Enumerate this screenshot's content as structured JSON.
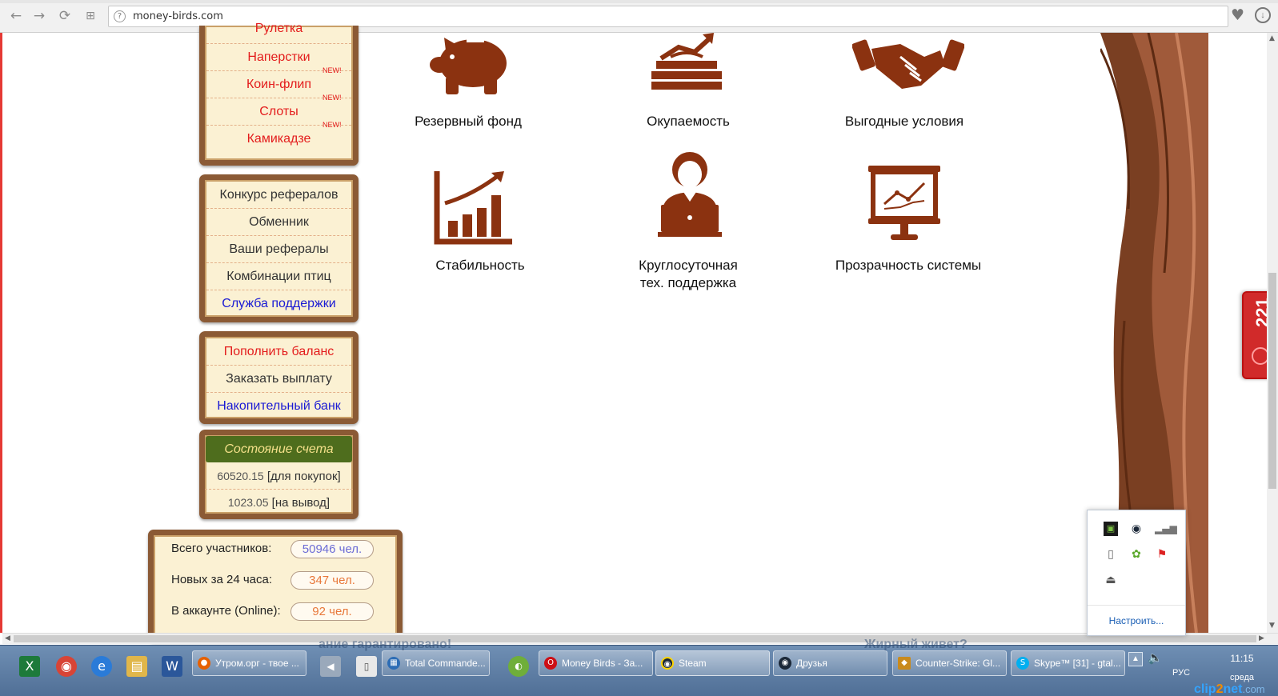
{
  "browser": {
    "url": "money-birds.com"
  },
  "sidebar": {
    "games": [
      {
        "label": "Рулетка",
        "color": "red",
        "new": false
      },
      {
        "label": "Наперстки",
        "color": "red",
        "new": false
      },
      {
        "label": "Коин-флип",
        "color": "red",
        "new": true
      },
      {
        "label": "Слоты",
        "color": "red",
        "new": true
      },
      {
        "label": "Камикадзе",
        "color": "red",
        "new": true
      }
    ],
    "new_tag": "NEW!",
    "referral": [
      {
        "label": "Конкурс рефералов",
        "color": "dark"
      },
      {
        "label": "Обменник",
        "color": "dark"
      },
      {
        "label": "Ваши рефералы",
        "color": "dark"
      },
      {
        "label": "Комбинации птиц",
        "color": "dark"
      },
      {
        "label": "Служба поддержки",
        "color": "blue"
      }
    ],
    "finance": [
      {
        "label": "Пополнить баланс",
        "color": "red"
      },
      {
        "label": "Заказать выплату",
        "color": "dark"
      },
      {
        "label": "Накопительный банк",
        "color": "blue"
      }
    ],
    "account_status": {
      "title": "Состояние счета",
      "purchase_amount": "60520.15",
      "purchase_label": "[для покупок]",
      "withdraw_amount": "1023.05",
      "withdraw_label": "[на вывод]"
    },
    "stats": [
      {
        "label": "Всего участников:",
        "value": "50946 чел.",
        "color": "#6b6bd6"
      },
      {
        "label": "Новых за 24 часа:",
        "value": "347 чел.",
        "color": "#e8783a"
      },
      {
        "label": "В аккаунте (Online):",
        "value": "92 чел.",
        "color": "#e8783a"
      }
    ]
  },
  "features": [
    {
      "label": "Резервный фонд",
      "icon": "piggy-bank-icon"
    },
    {
      "label": "Окупаемость",
      "icon": "money-stack-icon"
    },
    {
      "label": "Выгодные условия",
      "icon": "handshake-icon"
    },
    {
      "label": "Стабильность",
      "icon": "growth-chart-icon"
    },
    {
      "label_line1": "Круглосуточная",
      "label_line2": "тех. поддержка",
      "icon": "support-operator-icon"
    },
    {
      "label": "Прозрачность системы",
      "icon": "presentation-board-icon"
    }
  ],
  "side_widget": {
    "count": "221"
  },
  "tray_popup": {
    "customize_link": "Настроить..."
  },
  "taskbar": {
    "buttons": [
      {
        "label": "Утром.орг - твое ...",
        "icon": "firefox-icon",
        "color": "#e66000"
      },
      {
        "label": "Total Commande...",
        "icon": "total-commander-icon",
        "color": "#2d6db5"
      },
      {
        "label": "Money Birds - За...",
        "icon": "opera-icon",
        "color": "#cc0f16"
      },
      {
        "label": "Steam",
        "icon": "steam-icon",
        "color": "#1b2838"
      },
      {
        "label": "Друзья",
        "icon": "steam-icon",
        "color": "#1b2838"
      },
      {
        "label": "Counter-Strike: Gl...",
        "icon": "csgo-icon",
        "color": "#c98a1c"
      },
      {
        "label": "Skype™ [31] - gtal...",
        "icon": "skype-icon",
        "color": "#00aff0"
      }
    ],
    "ghost_text_1": "ание гарантировано!",
    "ghost_text_2": "Жирный живет?",
    "language": "РУС",
    "time": "11:15",
    "day": "среда"
  },
  "watermark": {
    "brand_a": "clip",
    "brand_b": "2",
    "brand_c": "net",
    "brand_d": ".com"
  },
  "colors": {
    "icon_brown": "#8b3210",
    "wood": "#8b5a35",
    "parchment": "#fbf1d3"
  }
}
